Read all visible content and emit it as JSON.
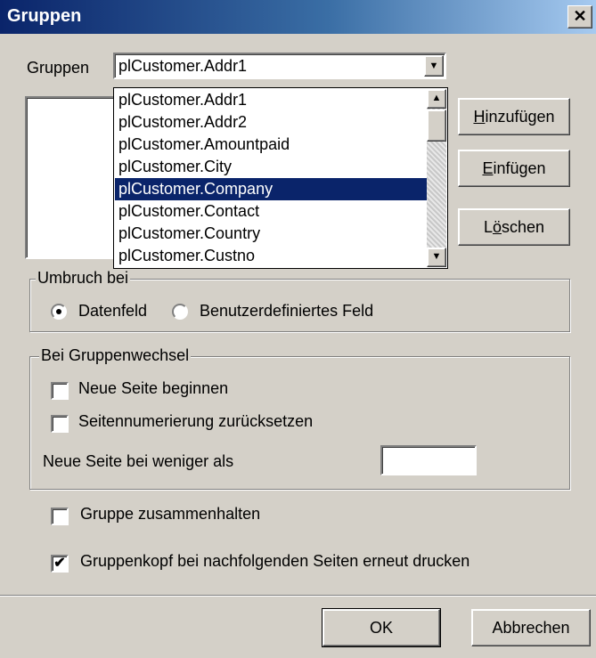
{
  "window": {
    "title": "Gruppen",
    "close_glyph": "✕"
  },
  "groups": {
    "label": "Gruppen",
    "selected_value": "plCustomer.Addr1",
    "dropdown_items": [
      "plCustomer.Addr1",
      "plCustomer.Addr2",
      "plCustomer.Amountpaid",
      "plCustomer.City",
      "plCustomer.Company",
      "plCustomer.Contact",
      "plCustomer.Country",
      "plCustomer.Custno"
    ],
    "highlighted_item": "plCustomer.Company"
  },
  "buttons": {
    "add": {
      "pre": "",
      "accel": "H",
      "post": "inzufügen"
    },
    "insert": {
      "pre": "",
      "accel": "E",
      "post": "infügen"
    },
    "delete": {
      "pre": "L",
      "accel": "ö",
      "post": "schen"
    },
    "ok": "OK",
    "cancel": "Abbrechen"
  },
  "break_on": {
    "legend": "Umbruch bei",
    "option_datafield": "Datenfeld",
    "option_custom": "Benutzerdefiniertes Feld",
    "selected": "Datenfeld"
  },
  "group_change": {
    "legend": "Bei Gruppenwechsel",
    "new_page_label": "Neue Seite beginnen",
    "new_page_checked": false,
    "reset_numbering_label": "Seitennumerierung zurücksetzen",
    "reset_numbering_checked": false,
    "new_page_if_less_label": "Neue Seite bei weniger als",
    "new_page_if_less_value": ""
  },
  "options": {
    "keep_together_label": "Gruppe zusammenhalten",
    "keep_together_checked": false,
    "reprint_header_label": "Gruppenkopf bei nachfolgenden Seiten erneut drucken",
    "reprint_header_checked": true,
    "check_glyph": "✔"
  },
  "icons": {
    "dropdown_arrow": "▼",
    "scroll_up": "▲",
    "scroll_down": "▼"
  },
  "colors": {
    "title_bar": "#0a246a",
    "selection": "#0a246a",
    "face": "#d4d0c8"
  }
}
